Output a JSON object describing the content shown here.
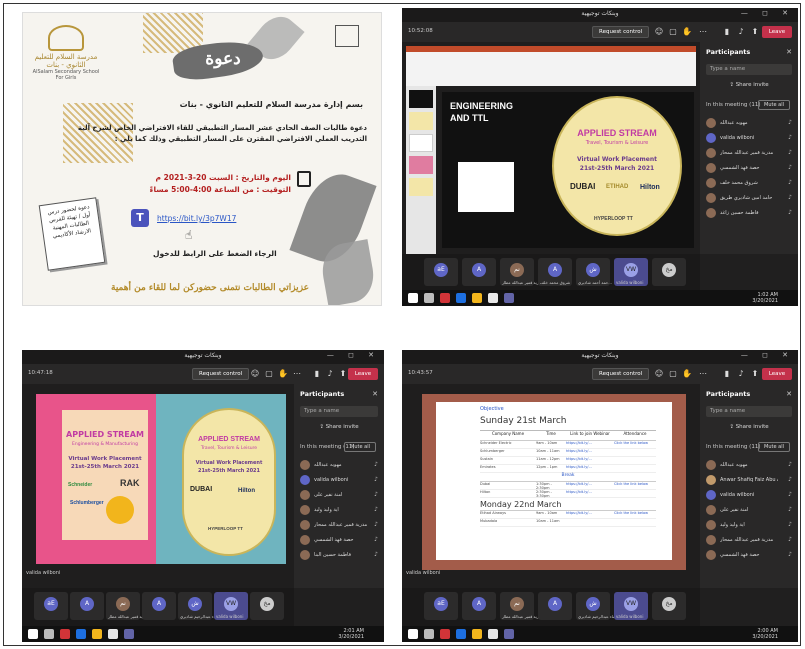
{
  "poster": {
    "title": "دعوة",
    "school_logo_text": "مدرسة السلام للتعليم الثانوي - بنات",
    "school_logo_en": "AlSalam Secondary School For Girls",
    "school_line": "بسم إدارة مدرسة السلام للتعليم الثانوي - بنات",
    "paragraph": "دعوة طالبات الصف الحادي عشر المسار التطبيقي للقاء الافتراضي الخاص لشرح آلية التدريب العملي الافتراضي المقترن على المسار التطبيقي وذلك كما يلي :",
    "date": "اليوم والتاريخ : السبت 20-3-2021 م",
    "time": "التوقيت : من الساعة 4:00-5:00 مساءً",
    "link": "https://bit.ly/3p7W17",
    "press": "الرجاء الضغط على الرابط للدخول",
    "card": "دعوة لحضور درس أول / تهيئة للفرس الطالبات المهنية الارشاد الأكاديمي",
    "footer": "عزيزاتي الطالبات نتمنى حضوركن لما للقاء من أهمية",
    "icons": [
      "teams-icon",
      "calendar-icon",
      "pointer-hand-icon"
    ]
  },
  "teams": {
    "window_title": "وبنكات توجيهية",
    "request_control": "Request control",
    "leave": "Leave",
    "participants_title": "Participants",
    "type_name": "Type a name",
    "share_invite": "Share invite",
    "mute_all": "Mute all",
    "presenter_label": "valida wilboni"
  },
  "win1": {
    "timer": "10:52:08",
    "in_meeting": "In this meeting (11)",
    "slide_title": "ENGINEERING AND TTL",
    "participants": [
      "مهوبه عبدالله",
      "valida wilboni",
      "مدرية قمير عبدالله ممحار",
      "حصة فهد الشمسي",
      "شروق محمد خلف",
      "حامد آمين شاديري طريق",
      "فاطمة حسين زاغد"
    ],
    "strip": [
      {
        "initials": "aE",
        "label": ""
      },
      {
        "initials": "A",
        "label": ""
      },
      {
        "initials": "نم",
        "label": "مدرية قمير عبدالله مطار"
      },
      {
        "initials": "A",
        "label": "شروق محمد خلف"
      },
      {
        "initials": "ش",
        "label": "حمة أحمد شاديري..."
      },
      {
        "initials": "VW",
        "label": "valida wilboni"
      },
      {
        "initials": "مخ",
        "label": ""
      }
    ],
    "clock": "1:02 AM\n3/20/2021"
  },
  "win2": {
    "timer": "10:47:18",
    "in_meeting": "In this meeting (11)",
    "participants": [
      "مهوبه عبدالله",
      "valida wilboni",
      "أمنة نفير على",
      "آية وليد وليد",
      "مدرية قمير عبدالله ممحار",
      "حصة فهد الشمسي",
      "فاطمة حسين البنا"
    ],
    "strip": [
      {
        "initials": "aE",
        "label": ""
      },
      {
        "initials": "A",
        "label": ""
      },
      {
        "initials": "نم",
        "label": "مدرية قمير عبدالله مطار"
      },
      {
        "initials": "A",
        "label": ""
      },
      {
        "initials": "ش",
        "label": "شيماء عبدالرحيم شاديري..."
      },
      {
        "initials": "VW",
        "label": "valida wilboni"
      },
      {
        "initials": "مخ",
        "label": ""
      }
    ],
    "clock": "2:01 AM\n3/20/2021"
  },
  "win3": {
    "timer": "10:43:57",
    "in_meeting": "In this meeting (11)",
    "participants": [
      "مهوبه عبدالله",
      "Anwar Shafiq Faiz Abu Anz",
      "valida wilboni",
      "أمنة نفير على",
      "آية وليد وليد",
      "مدرية قمير عبدالله ممحار",
      "حصة فهد الشمسي"
    ],
    "strip": [
      {
        "initials": "aE",
        "label": ""
      },
      {
        "initials": "A",
        "label": ""
      },
      {
        "initials": "نم",
        "label": "مدرية قمير عبدالله مطار"
      },
      {
        "initials": "A",
        "label": ""
      },
      {
        "initials": "ش",
        "label": "شيماء عبدالرحيم شاديري..."
      },
      {
        "initials": "VW",
        "label": "valida wilboni"
      },
      {
        "initials": "مخ",
        "label": ""
      }
    ],
    "clock": "2:00 AM\n3/20/2021",
    "schedule": {
      "objective": "Objective",
      "day1": "Sunday 21st March",
      "headers": [
        "Company Name",
        "Time",
        "Link to join Webinar",
        "Attendance"
      ],
      "rows1": [
        [
          "Schneider Electric",
          "9am - 10am",
          "https://bit.ly/...",
          "Click the link below"
        ],
        [
          "Schlumberger",
          "10am - 11am",
          "https://bit.ly/...",
          ""
        ],
        [
          "Sustain",
          "11am - 12pm",
          "https://bit.ly/...",
          ""
        ],
        [
          "Emirates",
          "12pm - 1pm",
          "https://bit.ly/...",
          ""
        ]
      ],
      "break": "Break",
      "rows2": [
        [
          "Dubai",
          "1:30pm - 2:30pm",
          "https://bit.ly/...",
          "Click the link below"
        ],
        [
          "Hilton",
          "2:30pm - 3:30pm",
          "https://bit.ly/...",
          ""
        ]
      ],
      "day2": "Monday 22nd March",
      "rows3": [
        [
          "Etihad Airways",
          "9am - 10am",
          "https://bit.ly/...",
          "Click the link below"
        ],
        [
          "Mubadala",
          "10am - 11am",
          "",
          ""
        ]
      ]
    }
  },
  "slides": {
    "applied_title": "APPLIED STREAM",
    "applied_sub": "Travel, Tourism & Leisure",
    "applied_sub2": "Engineering & Manufacturing",
    "virtual": "Virtual Work Placement",
    "dates": "21st-25th March 2021",
    "brands": [
      "DUBAI",
      "ETIHAD",
      "Hilton",
      "HYPERLOOP TT",
      "RAK",
      "Schneider",
      "Schlumberger"
    ]
  }
}
